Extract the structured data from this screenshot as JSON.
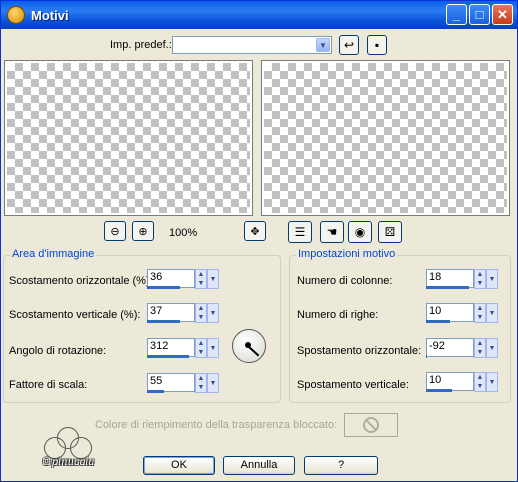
{
  "window": {
    "title": "Motivi"
  },
  "preset": {
    "label": "Imp. predef.:",
    "value": ""
  },
  "zoom": {
    "value": "100%"
  },
  "area": {
    "title": "Area d'immagine",
    "fields": [
      {
        "label": "Scostamento orizzontale (%):",
        "value": "36",
        "fill": 0.68
      },
      {
        "label": "Scostamento verticale (%):",
        "value": "37",
        "fill": 0.68
      },
      {
        "label": "Angolo di rotazione:",
        "value": "312",
        "fill": 0.87
      },
      {
        "label": "Fattore di scala:",
        "value": "55",
        "fill": 0.36
      }
    ]
  },
  "settings": {
    "title": "Impostazioni motivo",
    "fields": [
      {
        "label": "Numero di colonne:",
        "value": "18",
        "fill": 0.9
      },
      {
        "label": "Numero di righe:",
        "value": "10",
        "fill": 0.5
      },
      {
        "label": "Spostamento orizzontale:",
        "value": "-92",
        "fill": 0.02
      },
      {
        "label": "Spostamento verticale:",
        "value": "10",
        "fill": 0.55
      }
    ]
  },
  "fill": {
    "label": "Colore di riempimento della trasparenza bloccato:"
  },
  "buttons": {
    "ok": "OK",
    "cancel": "Annulla",
    "help": "?"
  },
  "logo": {
    "text": "©pinuccia"
  }
}
